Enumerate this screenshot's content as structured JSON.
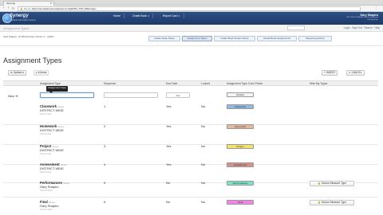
{
  "browser": {
    "tab_title": "Synergy",
    "url_scheme": "Secure",
    "url": "https://ca-sufield-test.edupoint.com/gbPSN_TXP_MAIN.aspx"
  },
  "header": {
    "logo_text": "Synergy",
    "logo_sub": "Student Information System",
    "nav": [
      "Home",
      "Grade Book",
      "Report Card"
    ],
    "user_name": "Gary Shapiro",
    "user_line1": "2017-2018 CA Middle School Gradebook",
    "user_line2": "Fall Semester"
  },
  "subheader": {
    "nav_title": "Assignment Types",
    "links": "Login · Sign Out · Search · Help"
  },
  "toolbar": {
    "breadcrumb": "(Gd) Shapiro, Gr 8/9 Diversity 3/4 Per 1 - 2/4/8n",
    "tabs": [
      "Grade Scale Setup",
      "Assignment Types",
      "Grade Book Screen Setup",
      "Grade Book Assignments",
      "Reporting Activity"
    ]
  },
  "page": {
    "title": "Assignment Types",
    "options_label": "Options",
    "items_label": "6 Items",
    "insert_label": "INSERT",
    "cancel_label": "CANCEL",
    "new_label": "New"
  },
  "columns": [
    "Assignment Type",
    "Sequence",
    "Due Date",
    "Locked",
    "Assignment Type Color Picker",
    "Hide My Types"
  ],
  "tooltip": "Assignment Type",
  "new_row": {
    "sequence_value": "",
    "due_date_value": "Yes",
    "color_label": "Default"
  },
  "rows": [
    {
      "name": "Classwork",
      "scope": "Scope",
      "owner": "DISTRICT WIDE",
      "tag": "District Data",
      "sequence": "1",
      "due_date": "Yes",
      "locked": "No",
      "color_label": "Classwork",
      "color": "#8fb9e0",
      "has_button": false
    },
    {
      "name": "Homework",
      "scope": "Scope",
      "owner": "DISTRICT WIDE",
      "tag": "District Data",
      "sequence": "2",
      "due_date": "Yes",
      "locked": "No",
      "color_label": "Homework",
      "color": "#e7b79c",
      "has_button": false
    },
    {
      "name": "Project",
      "scope": "Scope",
      "owner": "DISTRICT WIDE",
      "tag": "District Data",
      "sequence": "3",
      "due_date": "Yes",
      "locked": "No",
      "color_label": "Project",
      "color": "#f3e36e",
      "has_button": false
    },
    {
      "name": "Assessment",
      "scope": "Scope",
      "owner": "DISTRICT WIDE",
      "tag": "District Data",
      "sequence": "4",
      "due_date": "Yes",
      "locked": "No",
      "color_label": "Assessment",
      "color": "#d98f87",
      "has_button": false
    },
    {
      "name": "Performances",
      "scope": "Scope",
      "owner": "Gary Shapiro",
      "tag": "Teacher Data",
      "sequence": "5",
      "due_date": "No",
      "locked": "No",
      "color_label": "Performances",
      "color": "#7fe0c8",
      "has_button": true,
      "button_label": "Secure Measure Type"
    },
    {
      "name": "Final",
      "scope": "Scope",
      "owner": "Gary Shapiro",
      "tag": "Teacher Data",
      "sequence": "6",
      "due_date": "No",
      "locked": "No",
      "color_label": "Final",
      "color": "#ef86e5",
      "has_button": true,
      "button_label": "Secure Measure Type"
    }
  ]
}
